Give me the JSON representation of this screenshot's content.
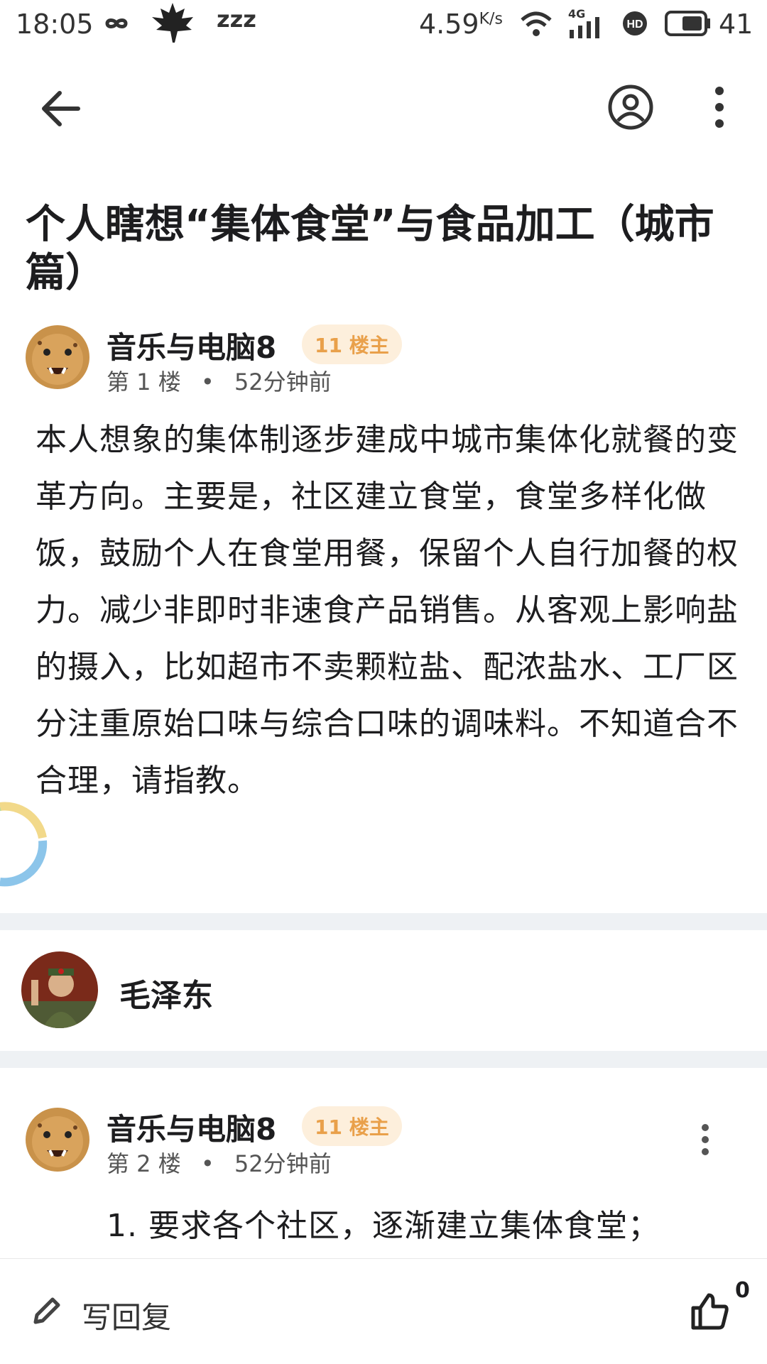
{
  "status_bar": {
    "time": "18:05",
    "zzz": "zzz",
    "speed": "4.59",
    "speed_unit": "K/s",
    "network": "4G",
    "battery": "41"
  },
  "post": {
    "title": "个人瞎想“集体食堂”与食品加工（城市篇）",
    "author": "音乐与电脑8",
    "badge": "11 楼主",
    "floor": "第 1 楼",
    "dot": "•",
    "time": "52分钟前",
    "body": "本人想象的集体制逐步建成中城市集体化就餐的变革方向。主要是，社区建立食堂，食堂多样化做饭，鼓励个人在食堂用餐，保留个人自行加餐的权力。减少非即时非速食产品销售。从客观上影响盐的摄入，比如超市不卖颗粒盐、配浓盐水、工厂区分注重原始口味与综合口味的调味料。不知道合不合理，请指教。"
  },
  "user_card": {
    "name": "毛泽东"
  },
  "reply": {
    "author": "音乐与电脑8",
    "badge": "11 楼主",
    "floor": "第 2 楼",
    "dot": "•",
    "time": "52分钟前",
    "body": "1. 要求各个社区，逐渐建立集体食堂；"
  },
  "bottom_bar": {
    "reply_label": "写回复",
    "like_count": "0"
  },
  "colors": {
    "badge_bg": "#fdefdc",
    "badge_text": "#e9a04a",
    "divider": "#eef1f4"
  },
  "icons": [
    "infinity-icon",
    "maple-leaf-icon",
    "wifi-icon",
    "signal-icon",
    "hd-icon",
    "battery-icon",
    "back-arrow-icon",
    "profile-icon",
    "more-vertical-icon",
    "pencil-icon",
    "thumbs-up-icon"
  ]
}
